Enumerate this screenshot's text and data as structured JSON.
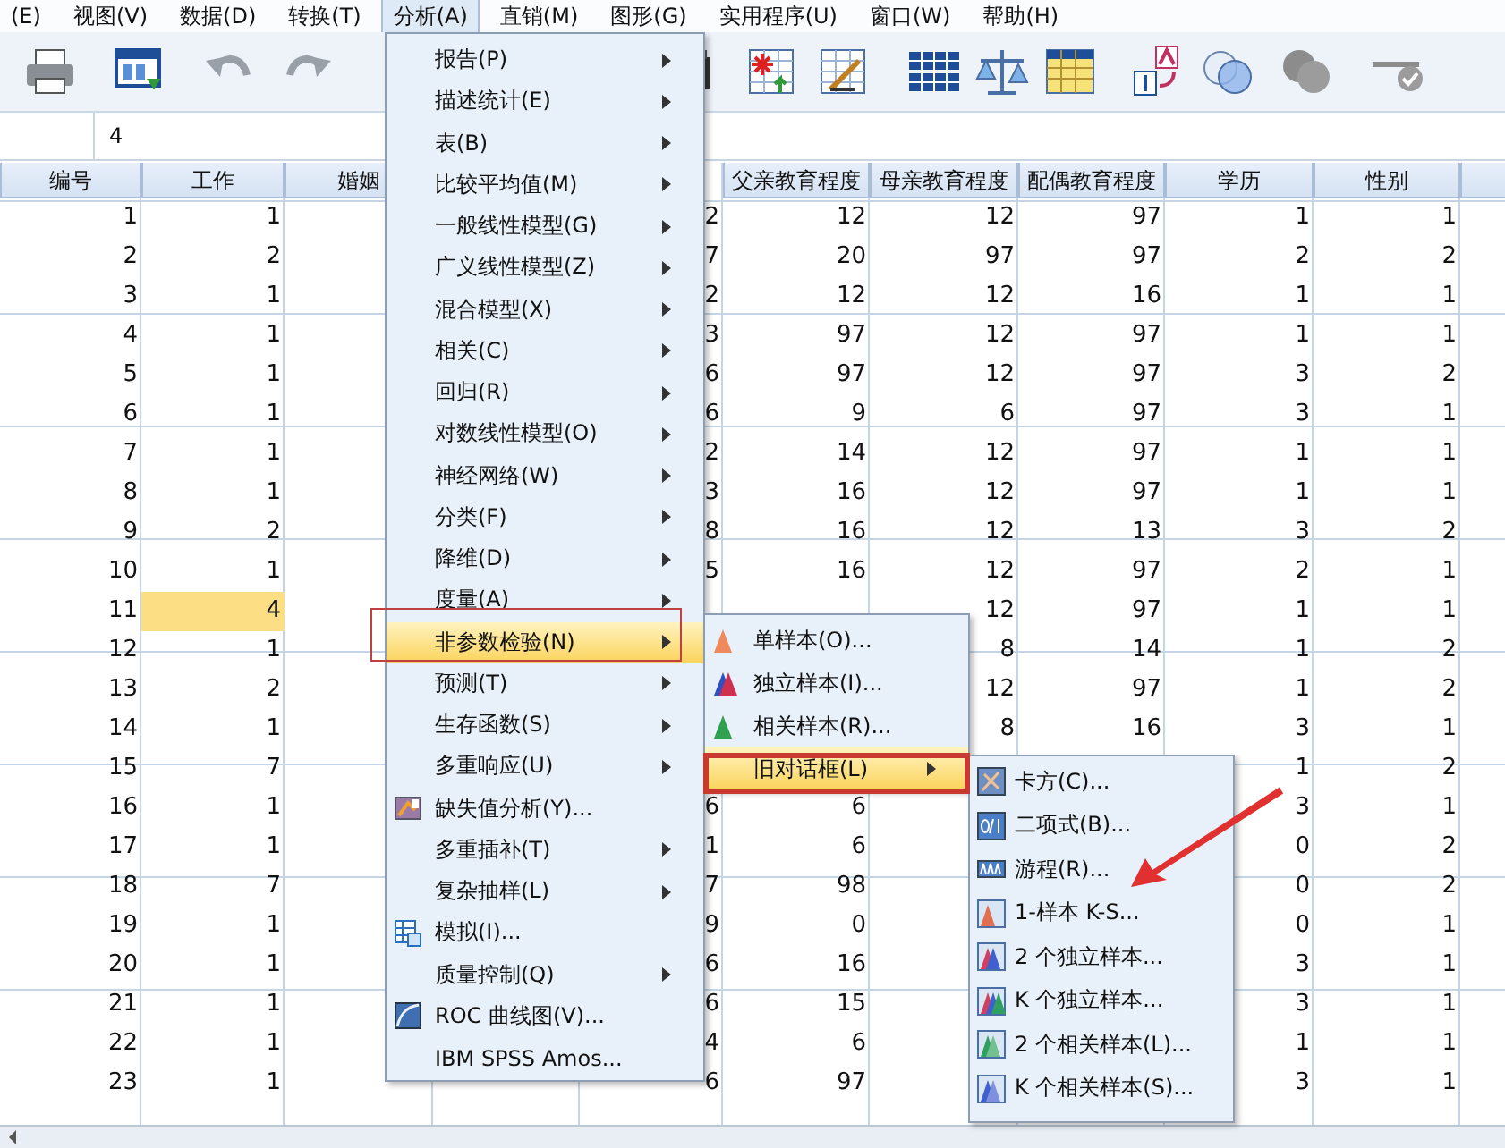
{
  "menubar": [
    {
      "label": "(E)",
      "selected": false
    },
    {
      "label": "视图(V)",
      "selected": false
    },
    {
      "label": "数据(D)",
      "selected": false
    },
    {
      "label": "转换(T)",
      "selected": false
    },
    {
      "label": "分析(A)",
      "selected": true
    },
    {
      "label": "直销(M)",
      "selected": false
    },
    {
      "label": "图形(G)",
      "selected": false
    },
    {
      "label": "实用程序(U)",
      "selected": false
    },
    {
      "label": "窗口(W)",
      "selected": false
    },
    {
      "label": "帮助(H)",
      "selected": false
    }
  ],
  "cell_editor": {
    "value": "4"
  },
  "table": {
    "columns": [
      "编号",
      "工作",
      "婚姻",
      null,
      null,
      "父亲教育程度",
      "母亲教育程度",
      "配偶教育程度",
      "学历",
      "性别",
      null
    ],
    "rows": [
      {
        "cells": [
          "1",
          "1",
          null,
          null,
          "2",
          "12",
          "12",
          "97",
          "1",
          "1"
        ]
      },
      {
        "cells": [
          "2",
          "2",
          null,
          null,
          "7",
          "20",
          "97",
          "97",
          "2",
          "2"
        ]
      },
      {
        "cells": [
          "3",
          "1",
          null,
          null,
          "2",
          "12",
          "12",
          "16",
          "1",
          "1"
        ]
      },
      {
        "cells": [
          "4",
          "1",
          null,
          null,
          "3",
          "97",
          "12",
          "97",
          "1",
          "1"
        ]
      },
      {
        "cells": [
          "5",
          "1",
          null,
          null,
          "6",
          "97",
          "12",
          "97",
          "3",
          "2"
        ]
      },
      {
        "cells": [
          "6",
          "1",
          null,
          null,
          "6",
          "9",
          "6",
          "97",
          "3",
          "1"
        ]
      },
      {
        "cells": [
          "7",
          "1",
          null,
          null,
          "2",
          "14",
          "12",
          "97",
          "1",
          "1"
        ]
      },
      {
        "cells": [
          "8",
          "1",
          null,
          null,
          "3",
          "16",
          "12",
          "97",
          "1",
          "1"
        ]
      },
      {
        "cells": [
          "9",
          "2",
          null,
          null,
          "8",
          "16",
          "12",
          "13",
          "3",
          "2"
        ]
      },
      {
        "cells": [
          "10",
          "1",
          null,
          null,
          "5",
          "16",
          "12",
          "97",
          "2",
          "1"
        ]
      },
      {
        "cells": [
          "11",
          {
            "text": "4",
            "selected": true
          },
          null,
          null,
          null,
          null,
          "12",
          "97",
          "1",
          "1"
        ]
      },
      {
        "cells": [
          "12",
          "1",
          null,
          null,
          null,
          null,
          "8",
          "14",
          "1",
          "2"
        ]
      },
      {
        "cells": [
          "13",
          "2",
          null,
          null,
          null,
          null,
          "12",
          "97",
          "1",
          "2"
        ]
      },
      {
        "cells": [
          "14",
          "1",
          null,
          null,
          null,
          null,
          "8",
          "16",
          "3",
          "1"
        ]
      },
      {
        "cells": [
          "15",
          "7",
          null,
          null,
          null,
          null,
          null,
          null,
          "1",
          "2"
        ]
      },
      {
        "cells": [
          "16",
          "1",
          null,
          null,
          "6",
          "6",
          null,
          null,
          "3",
          "1"
        ]
      },
      {
        "cells": [
          "17",
          "1",
          null,
          null,
          "1",
          "6",
          null,
          null,
          "0",
          "2"
        ]
      },
      {
        "cells": [
          "18",
          "7",
          null,
          null,
          "7",
          "98",
          null,
          null,
          "0",
          "2"
        ]
      },
      {
        "cells": [
          "19",
          "1",
          null,
          null,
          "9",
          "0",
          null,
          null,
          "0",
          "1"
        ]
      },
      {
        "cells": [
          "20",
          "1",
          null,
          null,
          "6",
          "16",
          null,
          null,
          "3",
          "1"
        ]
      },
      {
        "cells": [
          "21",
          "1",
          null,
          null,
          "6",
          "15",
          null,
          null,
          "3",
          "1"
        ]
      },
      {
        "cells": [
          "22",
          "1",
          null,
          null,
          "4",
          "6",
          null,
          null,
          "1",
          "1"
        ]
      },
      {
        "cells": [
          "23",
          "1",
          null,
          null,
          "6",
          "97",
          null,
          null,
          "3",
          "1"
        ]
      }
    ]
  },
  "analyze_menu": {
    "items": [
      {
        "label": "报告(P)",
        "submenu": true,
        "kind": "plain",
        "selected": false
      },
      {
        "label": "描述统计(E)",
        "submenu": true,
        "kind": "plain",
        "selected": false
      },
      {
        "label": "表(B)",
        "submenu": true,
        "kind": "plain",
        "selected": false
      },
      {
        "label": "比较平均值(M)",
        "submenu": true,
        "kind": "plain",
        "selected": false
      },
      {
        "label": "一般线性模型(G)",
        "submenu": true,
        "kind": "plain",
        "selected": false
      },
      {
        "label": "广义线性模型(Z)",
        "submenu": true,
        "kind": "plain",
        "selected": false
      },
      {
        "label": "混合模型(X)",
        "submenu": true,
        "kind": "plain",
        "selected": false
      },
      {
        "label": "相关(C)",
        "submenu": true,
        "kind": "plain",
        "selected": false
      },
      {
        "label": "回归(R)",
        "submenu": true,
        "kind": "plain",
        "selected": false
      },
      {
        "label": "对数线性模型(O)",
        "submenu": true,
        "kind": "plain",
        "selected": false
      },
      {
        "label": "神经网络(W)",
        "submenu": true,
        "kind": "plain",
        "selected": false
      },
      {
        "label": "分类(F)",
        "submenu": true,
        "kind": "plain",
        "selected": false
      },
      {
        "label": "降维(D)",
        "submenu": true,
        "kind": "plain",
        "selected": false
      },
      {
        "label": "度量(A)",
        "submenu": true,
        "kind": "plain",
        "selected": false
      },
      {
        "label": "非参数检验(N)",
        "submenu": true,
        "kind": "plain",
        "selected": true
      },
      {
        "label": "预测(T)",
        "submenu": true,
        "kind": "plain",
        "selected": false
      },
      {
        "label": "生存函数(S)",
        "submenu": true,
        "kind": "plain",
        "selected": false
      },
      {
        "label": "多重响应(U)",
        "submenu": true,
        "kind": "plain",
        "selected": false
      },
      {
        "label": "缺失值分析(Y)...",
        "submenu": false,
        "kind": "missing",
        "selected": false
      },
      {
        "label": "多重插补(T)",
        "submenu": true,
        "kind": "plain",
        "selected": false
      },
      {
        "label": "复杂抽样(L)",
        "submenu": true,
        "kind": "plain",
        "selected": false
      },
      {
        "label": "模拟(I)...",
        "submenu": false,
        "kind": "simulation",
        "selected": false
      },
      {
        "label": "质量控制(Q)",
        "submenu": true,
        "kind": "plain",
        "selected": false
      },
      {
        "label": "ROC 曲线图(V)...",
        "submenu": false,
        "kind": "roc",
        "selected": false
      },
      {
        "label": "IBM SPSS Amos...",
        "submenu": false,
        "kind": "plain",
        "selected": false
      }
    ]
  },
  "nonparametric_menu": {
    "items": [
      {
        "label": "单样本(O)...",
        "submenu": false,
        "kind": "one",
        "selected": false
      },
      {
        "label": "独立样本(I)...",
        "submenu": false,
        "kind": "independent",
        "selected": false
      },
      {
        "label": "相关样本(R)...",
        "submenu": false,
        "kind": "related",
        "selected": false
      },
      {
        "label": "旧对话框(L)",
        "submenu": true,
        "kind": "plain",
        "selected": true
      }
    ]
  },
  "legacy_menu": {
    "items": [
      {
        "label": "卡方(C)...",
        "kind": "chi"
      },
      {
        "label": "二项式(B)...",
        "kind": "binomial"
      },
      {
        "label": "游程(R)...",
        "kind": "runs"
      },
      {
        "label": "1-样本 K-S...",
        "kind": "ks"
      },
      {
        "label": "2 个独立样本...",
        "kind": "two-ind"
      },
      {
        "label": "K 个独立样本...",
        "kind": "k-ind"
      },
      {
        "label": "2 个相关样本(L)...",
        "kind": "two-rel"
      },
      {
        "label": "K 个相关样本(S)...",
        "kind": "k-rel"
      }
    ]
  }
}
